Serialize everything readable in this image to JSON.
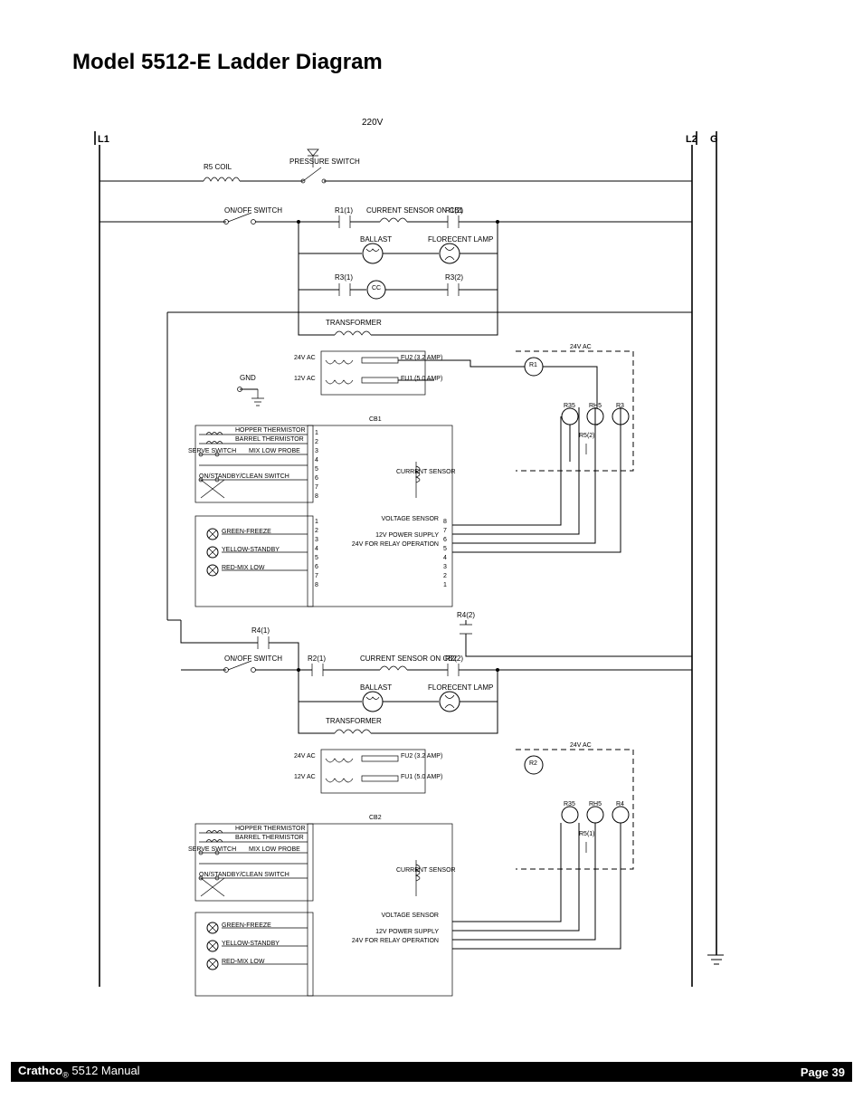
{
  "title": "Model 5512-E Ladder Diagram",
  "footer": {
    "brand": "Crathco",
    "manual": "5512 Manual",
    "page": "Page 39"
  },
  "header": {
    "voltage": "220V",
    "L1": "L1",
    "L2": "L2",
    "G": "G"
  },
  "labels_common": {
    "pressure_switch": "PRESSURE SWITCH",
    "r5_coil": "R5 COIL",
    "on_off_switch": "ON/OFF SWITCH",
    "current_sensor_on_cb": "CURRENT SENSOR ON",
    "ballast": "BALLAST",
    "florecent_lamp": "FLORECENT LAMP",
    "transformer": "TRANSFORMER",
    "gnd": "GND",
    "v24_ac": "24V AC",
    "v12_ac": "12V AC",
    "fu2": "FU2 (3.2 AMP)",
    "fu1": "FU1 (5.0 AMP)",
    "hopper_thermistor": "HOPPER THERMISTOR",
    "barrel_thermistor": "BARREL THERMISTOR",
    "serve_switch": "SERVE SWITCH",
    "mix_low_probe": "MIX LOW PROBE",
    "on_standby_clean": "ON/STANDBY/CLEAN SWITCH",
    "current_sensor": "CURRENT SENSOR",
    "voltage_sensor": "VOLTAGE SENSOR",
    "pwr12": "12V POWER SUPPLY",
    "relay24": "24V FOR RELAY OPERATION",
    "green_freeze": "GREEN-FREEZE",
    "yellow_standby": "YELLOW-STANDBY",
    "red_mix_low": "RED-MIX LOW",
    "cc": "CC"
  },
  "section1": {
    "cb": "CB1",
    "r_a": "R1(1)",
    "r_b": "R1(2)",
    "r3a": "R3(1)",
    "r3b": "R3(2)",
    "r_coil": "R1",
    "coils": [
      "R35",
      "RH5",
      "R3"
    ],
    "r5_contact": "R5(2)",
    "pins_left": [
      "1",
      "2",
      "3",
      "4",
      "5",
      "6",
      "7",
      "8"
    ],
    "pins_right_top": [
      "8",
      "7",
      "6",
      "5"
    ],
    "pins_right_bot": [
      "4",
      "3",
      "2",
      "1"
    ],
    "lamp_pins": [
      "1",
      "2",
      "3",
      "4",
      "5",
      "6",
      "7",
      "8"
    ]
  },
  "section2": {
    "cb": "CB2",
    "r4a": "R4(1)",
    "r4b": "R4(2)",
    "r2a": "R2(1)",
    "r2b": "R2(2)",
    "r_coil": "R2",
    "coils": [
      "R35",
      "RH5",
      "R4"
    ],
    "r5_contact": "R5(1)"
  }
}
